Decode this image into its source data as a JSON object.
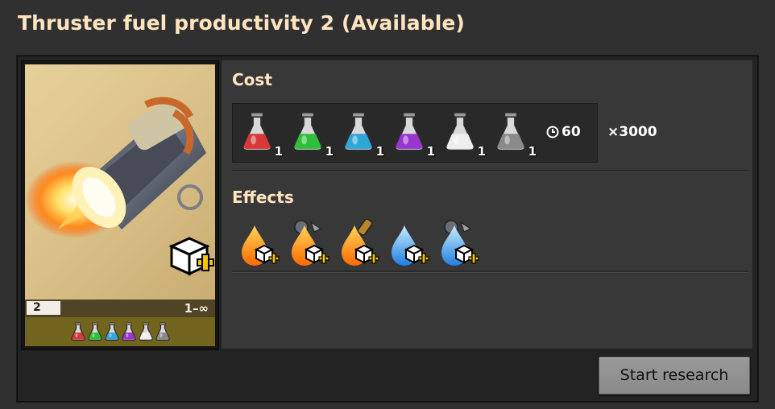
{
  "window": {
    "title": "Thruster fuel productivity 2 (Available)"
  },
  "card": {
    "level": "2",
    "range": "1–∞",
    "packs": [
      {
        "icon": "red-science-pack-icon",
        "color": "#d83838"
      },
      {
        "icon": "green-science-pack-icon",
        "color": "#2fbf3b"
      },
      {
        "icon": "blue-science-pack-icon",
        "color": "#2fa6d8"
      },
      {
        "icon": "purple-science-pack-icon",
        "color": "#9a35d0"
      },
      {
        "icon": "white-science-pack-icon",
        "color": "#eeeeee"
      },
      {
        "icon": "gray-science-pack-icon",
        "color": "#8a8a8a"
      }
    ]
  },
  "cost": {
    "label": "Cost",
    "packs": [
      {
        "name": "red-science-pack-icon",
        "count": "1",
        "color": "#d83838"
      },
      {
        "name": "green-science-pack-icon",
        "count": "1",
        "color": "#2fbf3b"
      },
      {
        "name": "blue-science-pack-icon",
        "count": "1",
        "color": "#2fa6d8"
      },
      {
        "name": "purple-science-pack-icon",
        "count": "1",
        "color": "#9a35d0"
      },
      {
        "name": "white-science-pack-icon",
        "count": "1",
        "color": "#eeeeee"
      },
      {
        "name": "gray-science-pack-icon",
        "count": "1",
        "color": "#8a8a8a"
      }
    ],
    "time": "60",
    "multiplier": "×3000"
  },
  "effects": {
    "label": "Effects",
    "items": [
      {
        "name": "thruster-fuel-productivity-icon"
      },
      {
        "name": "advanced-thruster-fuel-productivity-icon"
      },
      {
        "name": "thruster-fuel-ammo-productivity-icon"
      },
      {
        "name": "thruster-oxidizer-productivity-icon"
      },
      {
        "name": "advanced-thruster-oxidizer-productivity-icon"
      }
    ]
  },
  "actions": {
    "start_research": "Start research"
  }
}
